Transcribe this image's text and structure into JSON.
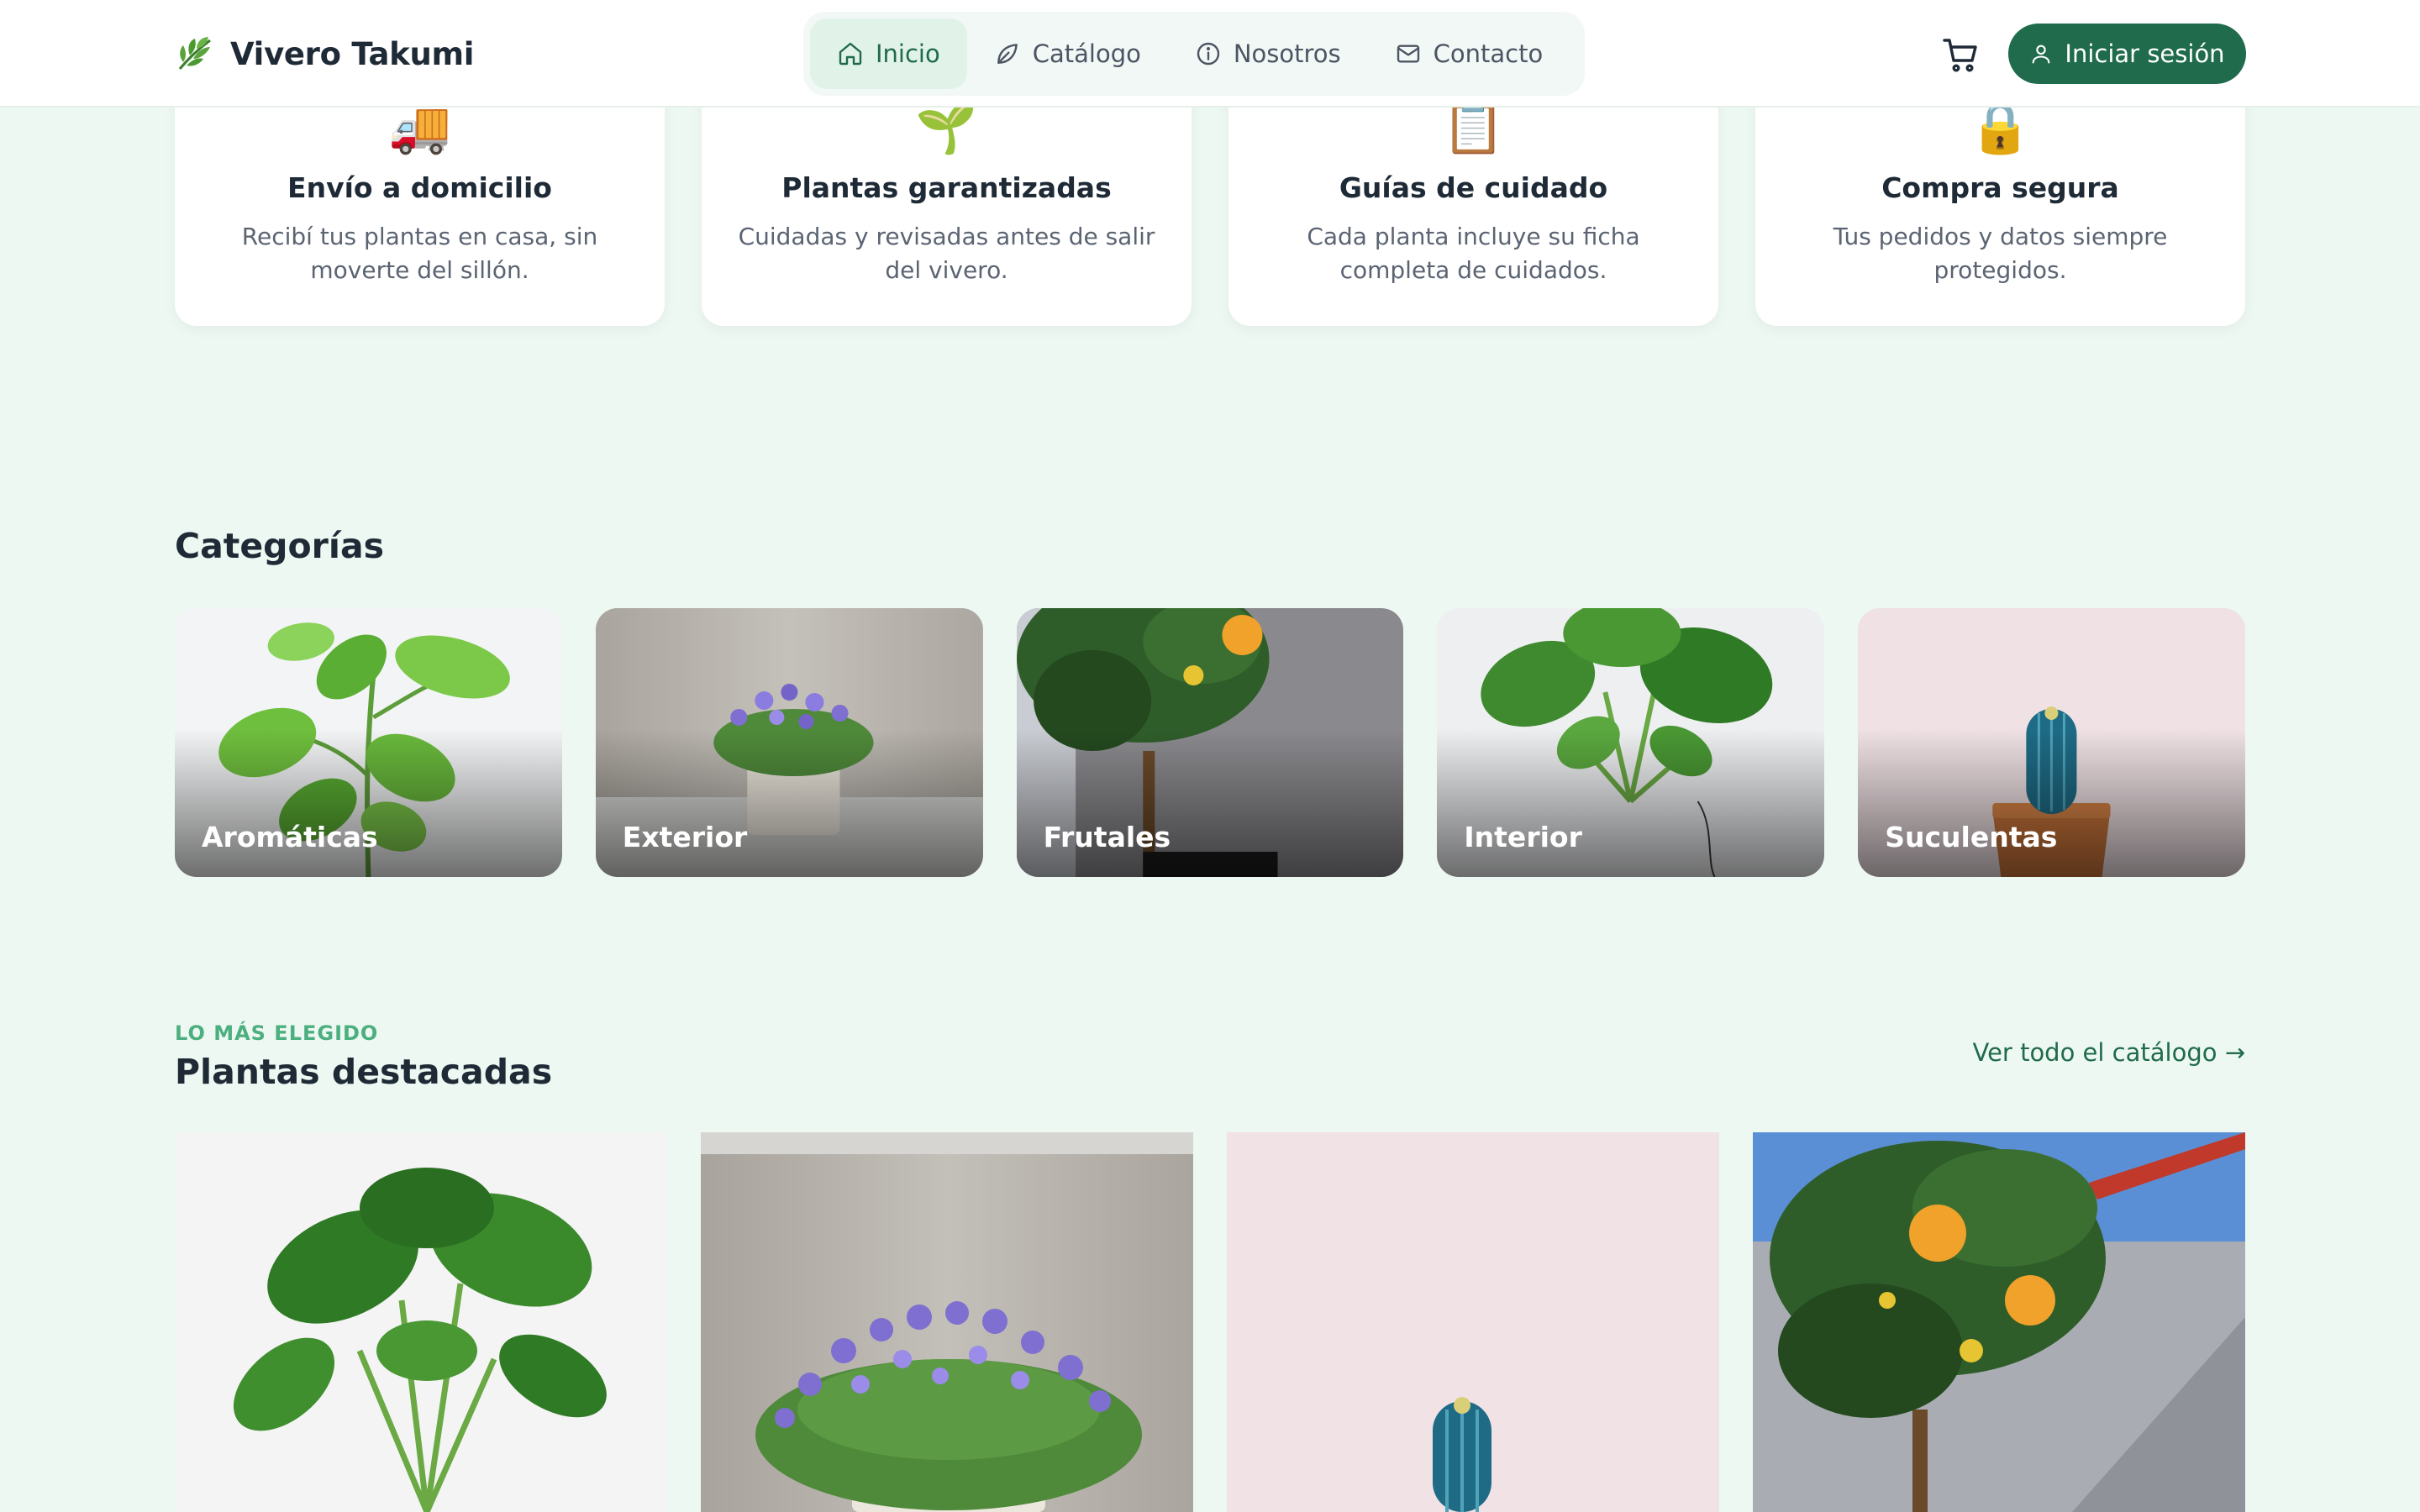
{
  "header": {
    "brand": "Vivero Takumi",
    "brand_icon": "leaf-icon",
    "nav": [
      {
        "label": "Inicio",
        "icon": "home-icon",
        "active": true
      },
      {
        "label": "Catálogo",
        "icon": "leaf-icon",
        "active": false
      },
      {
        "label": "Nosotros",
        "icon": "info-icon",
        "active": false
      },
      {
        "label": "Contacto",
        "icon": "mail-icon",
        "active": false
      }
    ],
    "cart_icon": "cart-icon",
    "login_label": "Iniciar sesión",
    "login_icon": "user-icon"
  },
  "features": [
    {
      "emoji": "🚚",
      "title": "Envío a domicilio",
      "text": "Recibí tus plantas en casa, sin moverte del sillón."
    },
    {
      "emoji": "🌱",
      "title": "Plantas garantizadas",
      "text": "Cuidadas y revisadas antes de salir del vivero."
    },
    {
      "emoji": "📋",
      "title": "Guías de cuidado",
      "text": "Cada planta incluye su ficha completa de cuidados."
    },
    {
      "emoji": "🔒",
      "title": "Compra segura",
      "text": "Tus pedidos y datos siempre protegidos."
    }
  ],
  "categories": {
    "title": "Categorías",
    "items": [
      {
        "label": "Aromáticas"
      },
      {
        "label": "Exterior"
      },
      {
        "label": "Frutales"
      },
      {
        "label": "Interior"
      },
      {
        "label": "Suculentas"
      }
    ]
  },
  "featured": {
    "eyebrow": "LO MÁS ELEGIDO",
    "title": "Plantas destacadas",
    "view_all": "Ver todo el catálogo →"
  },
  "colors": {
    "brand": "#1f6b4c",
    "accent": "#4caf7f",
    "background": "#eef8f2"
  }
}
